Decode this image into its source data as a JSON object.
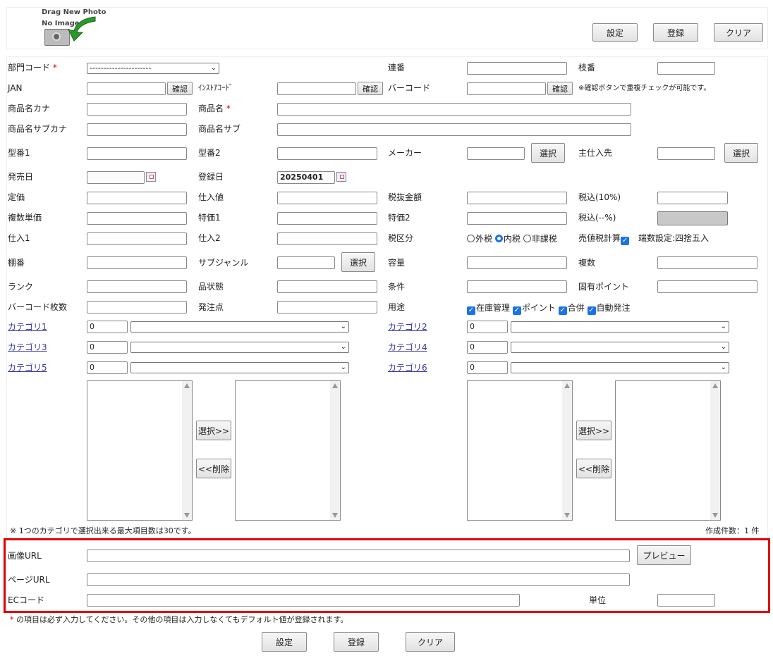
{
  "header": {
    "photo_drag_label": "Drag New Photo",
    "photo_no_image": "No Image",
    "btn_settings": "設定",
    "btn_register": "登録",
    "btn_clear": "クリア"
  },
  "form": {
    "dept_code_label": "部門コード",
    "required_mark": "*",
    "dept_code_value": "----------------------",
    "serial_label": "連番",
    "branch_label": "枝番",
    "jan_label": "JAN",
    "confirm_label": "確認",
    "instore_code_label": "ｲﾝｽﾄｱｺｰﾄﾞ",
    "barcode_label": "バーコード",
    "dup_note": "※確認ボタンで重複チェックが可能です。",
    "name_kana_label": "商品名カナ",
    "name_label": "商品名",
    "name_sub_kana_label": "商品名サブカナ",
    "name_sub_label": "商品名サブ",
    "model1_label": "型番1",
    "model2_label": "型番2",
    "maker_label": "メーカー",
    "select_label": "選択",
    "main_supplier_label": "主仕入先",
    "release_date_label": "発売日",
    "reg_date_label": "登録日",
    "reg_date_value": "20250401",
    "list_price_label": "定価",
    "cost_label": "仕入値",
    "tax_excl_label": "税抜金額",
    "tax_incl10_label": "税込(10%)",
    "multi_price_label": "複数単価",
    "special1_label": "特価1",
    "special2_label": "特価2",
    "tax_incl_other_label": "税込(--%)",
    "purchase1_label": "仕入1",
    "purchase2_label": "仕入2",
    "tax_class_label": "税区分",
    "tax_options": [
      "外税",
      "内税",
      "非課税"
    ],
    "tax_selected": "内税",
    "sales_tax_calc_label": "売値税計算",
    "rounding_label": "端数設定:四捨五入",
    "shelf_label": "棚番",
    "subgenre_label": "サブジャンル",
    "capacity_label": "容量",
    "multiple_label": "複数",
    "rank_label": "ランク",
    "condition_state_label": "品状態",
    "condition_label": "条件",
    "own_point_label": "固有ポイント",
    "barcode_count_label": "バーコード枚数",
    "order_point_label": "発注点",
    "usage_label": "用途",
    "usage_options": [
      "在庫管理",
      "ポイント",
      "合併",
      "自動発注"
    ],
    "category1_label": "カテゴリ1",
    "category2_label": "カテゴリ2",
    "category3_label": "カテゴリ3",
    "category4_label": "カテゴリ4",
    "category5_label": "カテゴリ5",
    "category6_label": "カテゴリ6",
    "category_value": "0",
    "select_add_label": "選択>>",
    "delete_label": "<<削除",
    "max_note": "※ 1つのカテゴリで選択出来る最大項目数は30です。",
    "created_count": "作成件数：1 件",
    "image_url_label": "画像URL",
    "preview_label": "プレビュー",
    "page_url_label": "ページURL",
    "ec_code_label": "ECコード",
    "unit_label": "単位",
    "footer_note": "の項目は必ず入力してください。その他の項目は入力しなくてもデフォルト値が登録されます。"
  },
  "colors": {
    "highlight_border": "#e00000",
    "required": "#cc0000",
    "checkbox": "#1a73e8"
  }
}
